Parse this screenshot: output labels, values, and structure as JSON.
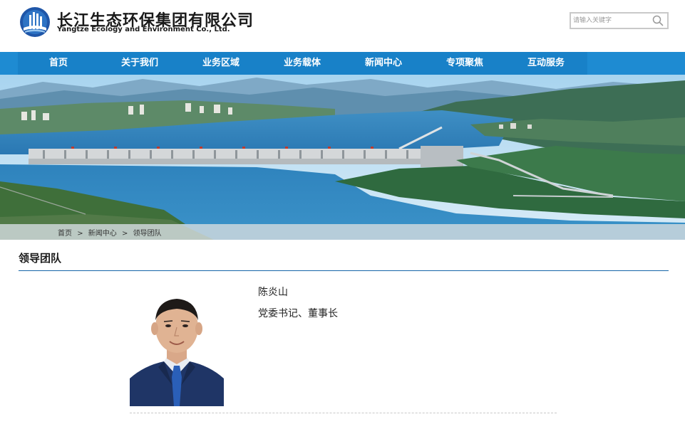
{
  "header": {
    "brand_cn": "长江生态环保集团有限公司",
    "brand_en": "Yangtze Ecology and Environment Co., Ltd.",
    "logo_icon": "yangtze-logo-icon",
    "search": {
      "placeholder": "请输入关键字",
      "icon": "search-icon"
    }
  },
  "nav": {
    "items": [
      {
        "label": "首页"
      },
      {
        "label": "关于我们"
      },
      {
        "label": "业务区域"
      },
      {
        "label": "业务载体"
      },
      {
        "label": "新闻中心"
      },
      {
        "label": "专项聚焦"
      },
      {
        "label": "互动服务"
      }
    ]
  },
  "breadcrumb": {
    "items": [
      "首页",
      "新闻中心",
      "领导团队"
    ],
    "separator": ">"
  },
  "section": {
    "title": "领导团队"
  },
  "leader": {
    "name": "陈炎山",
    "title": "党委书记、董事长"
  },
  "colors": {
    "nav_bg": "#1e8bd2",
    "nav_inner": "#1881c8",
    "rule": "#1565a8"
  }
}
